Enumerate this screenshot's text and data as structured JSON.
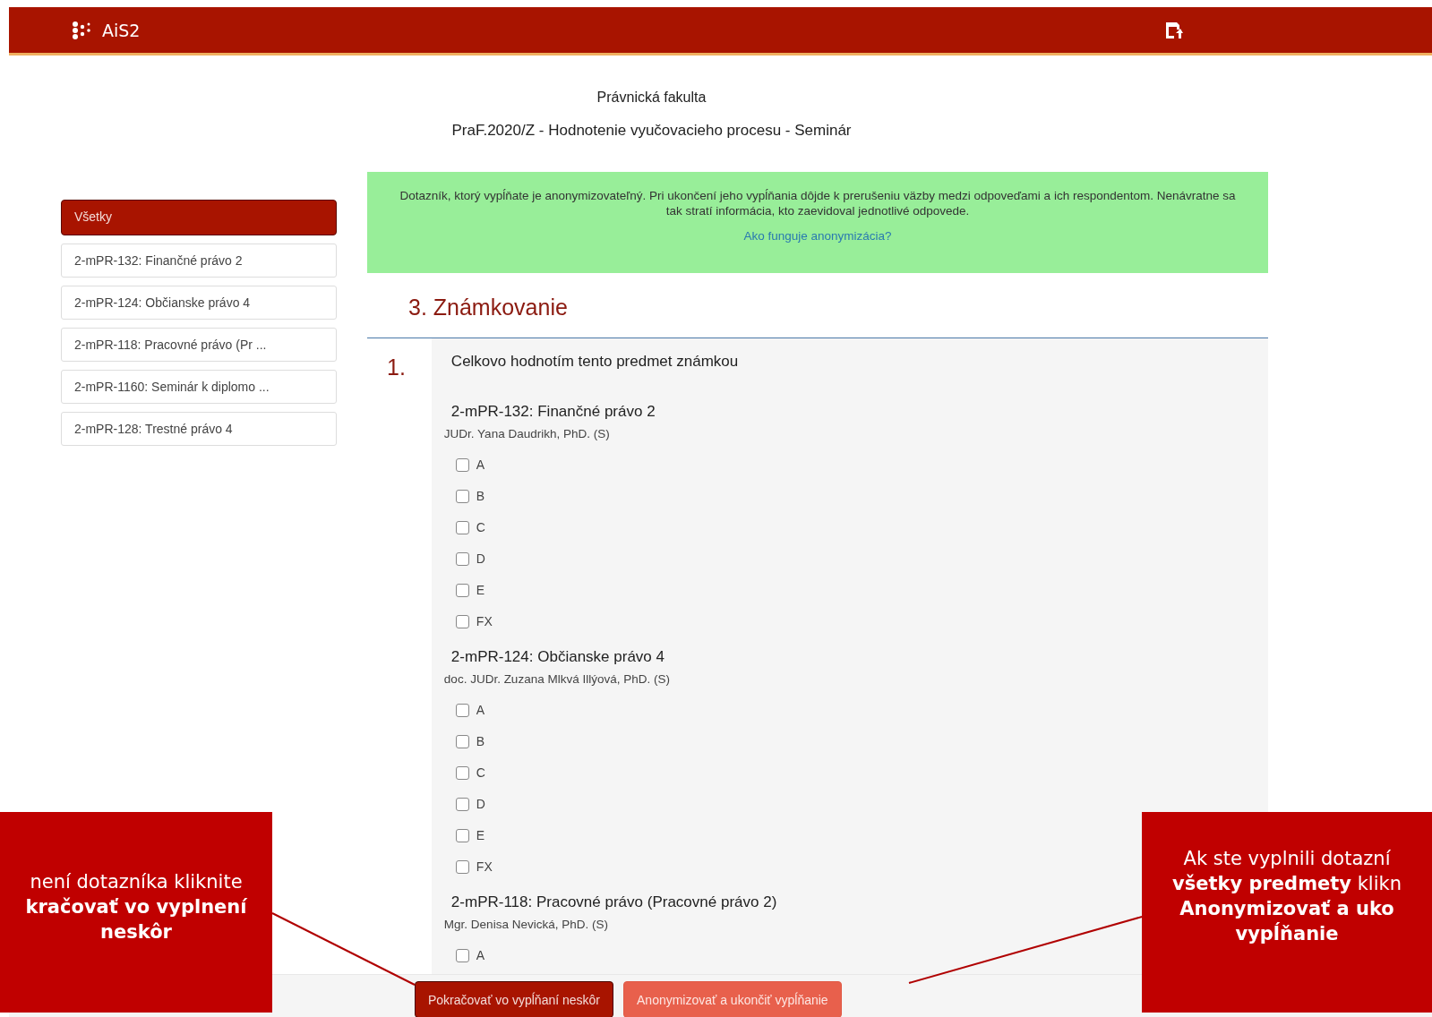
{
  "header": {
    "logo_text": "AiS2"
  },
  "faculty": "Právnická fakulta",
  "title": "PraF.2020/Z - Hodnotenie vyučovacieho procesu - Seminár",
  "sidebar": {
    "items": [
      {
        "label": "Všetky",
        "selected": true
      },
      {
        "label": "2-mPR-132: Finančné právo 2",
        "selected": false
      },
      {
        "label": "2-mPR-124: Občianske právo 4",
        "selected": false
      },
      {
        "label": "2-mPR-118: Pracovné právo (Pr ...",
        "selected": false
      },
      {
        "label": "2-mPR-1160: Seminár k diplomo ...",
        "selected": false
      },
      {
        "label": "2-mPR-128: Trestné právo 4",
        "selected": false
      }
    ]
  },
  "notice": {
    "text": "Dotazník, ktorý vypĺňate je anonymizovateľný. Pri ukončení jeho vypĺňania dôjde k prerušeniu väzby medzi odpoveďami a ich respondentom. Nenávratne sa tak stratí informácia, kto zaevidoval jednotlivé odpovede.",
    "link": "Ako funguje anonymizácia?"
  },
  "section": {
    "heading": "3. Známkovanie",
    "questions": [
      {
        "number": "1.",
        "text": "Celkovo hodnotím tento predmet známkou",
        "subjects": [
          {
            "title": "2-mPR-132: Finančné právo 2",
            "teacher": "JUDr. Yana Daudrikh, PhD. (S)",
            "options": [
              {
                "label": "A",
                "checked": false
              },
              {
                "label": "B",
                "checked": false
              },
              {
                "label": "C",
                "checked": false
              },
              {
                "label": "D",
                "checked": false
              },
              {
                "label": "E",
                "checked": false
              },
              {
                "label": "FX",
                "checked": false
              }
            ]
          },
          {
            "title": "2-mPR-124: Občianske právo 4",
            "teacher": "doc. JUDr. Zuzana Mlkvá Illýová, PhD. (S)",
            "options": [
              {
                "label": "A",
                "checked": false
              },
              {
                "label": "B",
                "checked": false
              },
              {
                "label": "C",
                "checked": false
              },
              {
                "label": "D",
                "checked": false
              },
              {
                "label": "E",
                "checked": false
              },
              {
                "label": "FX",
                "checked": false
              }
            ]
          },
          {
            "title": "2-mPR-118: Pracovné právo (Pracovné právo 2)",
            "teacher": "Mgr. Denisa Nevická, PhD. (S)",
            "options": [
              {
                "label": "A",
                "checked": false
              }
            ]
          }
        ]
      }
    ]
  },
  "footer": {
    "buttons": [
      {
        "label": "Pokračovať vo vypĺňaní neskôr",
        "kind": "primary"
      },
      {
        "label": "Anonymizovať a ukončiť vypĺňanie",
        "kind": "secondary"
      }
    ]
  },
  "callouts": [
    {
      "kind": "left",
      "lines": [
        "není dotazníka kliknite",
        "**kračovať vo vyplnení**",
        "**neskôr**"
      ]
    },
    {
      "kind": "right",
      "lines": [
        "Ak ste vyplnili dotazní",
        "**všetky predmety** klikn",
        "**Anonymizovať a uko**",
        "**vypĺňanie**"
      ]
    }
  ]
}
